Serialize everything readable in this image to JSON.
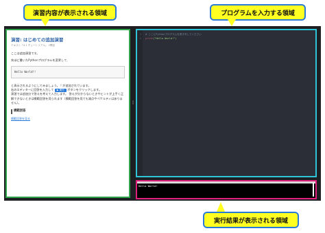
{
  "callouts": {
    "exercise": "演習内容が表示される領域",
    "input": "プログラムを入力する領域",
    "output": "実行結果が表示される領域"
  },
  "exercise": {
    "title": "演習: はじめての追加演習",
    "meta": "テキスト「4.1 チュートリアル」 2問目",
    "p1": "ここは追加演習です。",
    "p2": "先ほど書いたPythonプログラムを変更して、",
    "code": "Hello World!!",
    "p3": "と表示されるようにしてみましょう。 ! が追加されています。",
    "p4_before": "右のエディターに回答を入力して",
    "button": "▶ 実行",
    "p4_after": "ボタンをクリックします。",
    "p5": "演習では追加分で答えを考えて入力します。 答えが分からないときやヒントが上手く正解できないときは模範回答を見られます（模範回答を見ても減点やペナルティはありません）。",
    "section": "模範回答",
    "link": "模範回答を見る"
  },
  "editor": {
    "lines": [
      {
        "num": "1",
        "comment": "# ここにPythonプログラムを書き写してください"
      },
      {
        "num": "2",
        "fn": "print",
        "str": "(\"Hello World!\")"
      }
    ]
  },
  "output": {
    "text": "Hello World!"
  },
  "colors": {
    "exercise_border": "#2fa34a",
    "editor_border": "#2ec6d8",
    "output_border": "#e0207a",
    "callout_bg": "#ffff22"
  }
}
